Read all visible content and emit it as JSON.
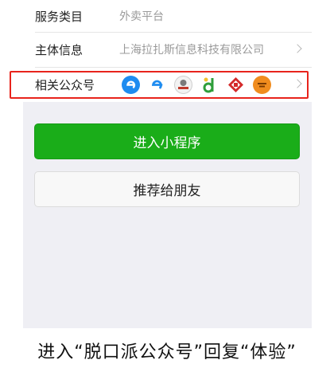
{
  "info": {
    "service_category_label": "服务类目",
    "service_category_value": "外卖平台",
    "entity_label": "主体信息",
    "entity_value": "上海拉扎斯信息科技有限公司",
    "related_accounts_label": "相关公众号",
    "related_accounts": [
      {
        "icon": "eleme-e-icon",
        "color": "#1e8cf0"
      },
      {
        "icon": "eleme-e-outline-icon",
        "color": "#1e8cf0"
      },
      {
        "icon": "rider-emblem-icon",
        "color": "#c0392b"
      },
      {
        "icon": "green-d-icon",
        "color": "#2e9e3a"
      },
      {
        "icon": "red-diamond-icon",
        "color": "#d42a2a"
      },
      {
        "icon": "orange-circle-icon",
        "color": "#f08c1e"
      }
    ]
  },
  "buttons": {
    "enter_mini_program": "进入小程序",
    "recommend_to_friends": "推荐给朋友"
  },
  "caption": "进入“脱口派公众号”回复“体验”"
}
